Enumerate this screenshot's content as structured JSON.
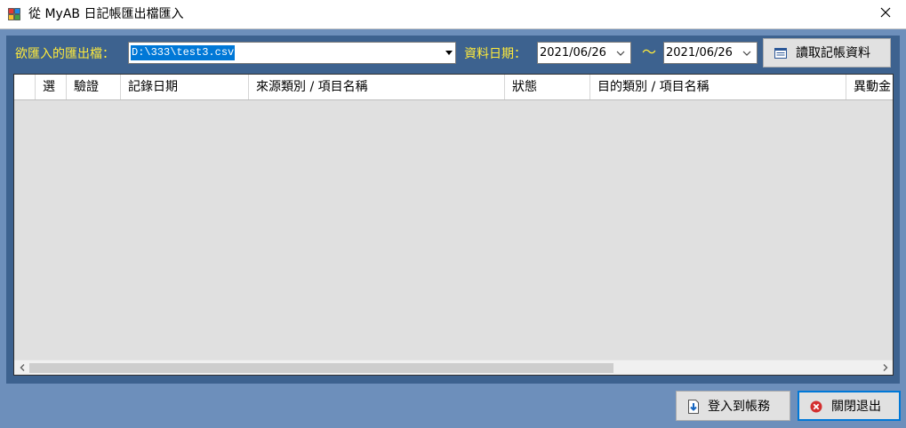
{
  "window": {
    "title": "從 MyAB 日記帳匯出檔匯入"
  },
  "toolbar": {
    "file_label": "欲匯入的匯出檔：",
    "file_value": "D:\\333\\test3.csv",
    "date_label": "資料日期：",
    "date_from": "2021/06/26",
    "tilde": "～",
    "date_to": "2021/06/26",
    "read_button_label": "讀取記帳資料"
  },
  "grid": {
    "columns": [
      {
        "key": "select",
        "label": "選"
      },
      {
        "key": "verify",
        "label": "驗證"
      },
      {
        "key": "record_date",
        "label": "記錄日期"
      },
      {
        "key": "source",
        "label": "來源類別 / 項目名稱"
      },
      {
        "key": "status",
        "label": "狀態"
      },
      {
        "key": "target",
        "label": "目的類別 / 項目名稱"
      },
      {
        "key": "amount",
        "label": "異動金"
      }
    ],
    "rows": []
  },
  "footer": {
    "import_button_label": "登入到帳務",
    "exit_button_label": "關閉退出"
  },
  "colors": {
    "panel": "#3d628f",
    "background": "#6d8fbb",
    "label_accent": "#ffeb3b",
    "selection": "#0078d7"
  },
  "icons": {
    "app": "app-grid-icon",
    "close": "close-icon",
    "read": "table-list-icon",
    "import": "document-import-icon",
    "exit": "red-x-circle-icon"
  }
}
